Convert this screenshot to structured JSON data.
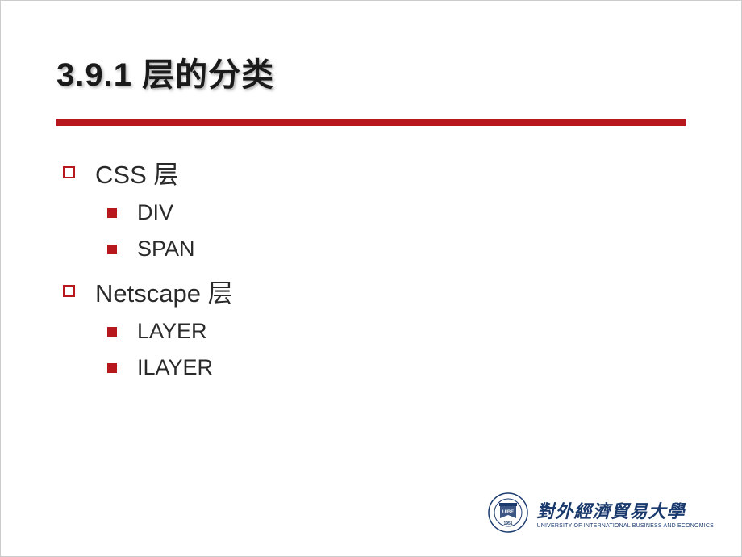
{
  "slide": {
    "title": "3.9.1 层的分类",
    "items": [
      {
        "label": "CSS 层",
        "children": [
          {
            "label": "DIV"
          },
          {
            "label": "SPAN"
          }
        ]
      },
      {
        "label": "Netscape 层",
        "children": [
          {
            "label": "LAYER"
          },
          {
            "label": "ILAYER"
          }
        ]
      }
    ]
  },
  "footer": {
    "university_cn": "對外經濟貿易大學",
    "university_en": "UNIVERSITY OF INTERNATIONAL BUSINESS AND ECONOMICS",
    "seal_year": "1951",
    "seal_abbr": "UIBE"
  },
  "colors": {
    "accent": "#b6181e",
    "logo": "#1a3a6e"
  }
}
